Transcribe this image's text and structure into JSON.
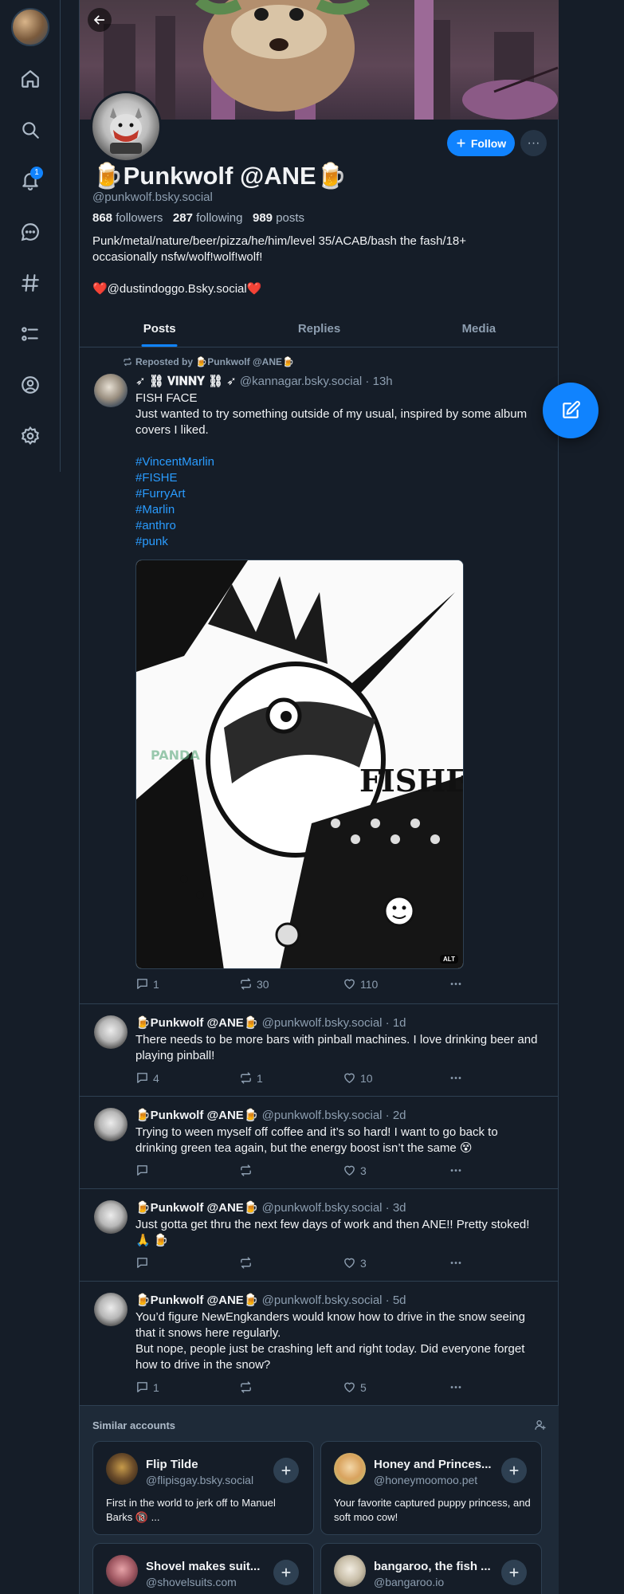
{
  "sidebar": {
    "notifications_badge": "1"
  },
  "profile": {
    "display_name": "🍺Punkwolf @ANE🍺",
    "handle": "@punkwolf.bsky.social",
    "followers_count": "868",
    "followers_label": "followers",
    "following_count": "287",
    "following_label": "following",
    "posts_count": "989",
    "posts_label": "posts",
    "bio_line1": "Punk/metal/nature/beer/pizza/he/him/level 35/ACAB/bash the fash/18+",
    "bio_line2": "occasionally nsfw/wolf!wolf!wolf!",
    "bio_line3": "❤️@dustindoggo.Bsky.social❤️",
    "follow_label": "Follow",
    "more_label": "···"
  },
  "tabs": [
    "Posts",
    "Replies",
    "Media"
  ],
  "feed": {
    "repost_label": "Reposted by 🍺Punkwolf @ANE🍺",
    "posts": [
      {
        "author": "➶ ⛓ 𝐕𝐈𝐍𝐍𝐘 ⛓ ➶",
        "handle": "@kannagar.bsky.social · 13h",
        "text_title": "FISH FACE",
        "text_body": "Just wanted to try something outside of my usual, inspired by some album covers I liked.",
        "hashtags": [
          "#VincentMarlin",
          "#FISHE",
          "#FurryArt",
          "#Marlin",
          "#anthro",
          "#punk"
        ],
        "image_alt_badge": "ALT",
        "image_text": "FISHE",
        "replies": "1",
        "reposts": "30",
        "likes": "110"
      },
      {
        "author": "🍺Punkwolf @ANE🍺",
        "handle": "@punkwolf.bsky.social · 1d",
        "text": "There needs to be more bars with pinball machines. I love drinking beer and playing pinball!",
        "replies": "4",
        "reposts": "1",
        "likes": "10"
      },
      {
        "author": "🍺Punkwolf @ANE🍺",
        "handle": "@punkwolf.bsky.social · 2d",
        "text": "Trying to ween myself off coffee and it’s so hard! I want to go back to drinking green tea again, but the energy boost isn’t the same 😵",
        "replies": "",
        "reposts": "",
        "likes": "3"
      },
      {
        "author": "🍺Punkwolf @ANE🍺",
        "handle": "@punkwolf.bsky.social · 3d",
        "text": "Just gotta get thru the next few days of work and then ANE!! Pretty stoked! 🙏 🍺",
        "replies": "",
        "reposts": "",
        "likes": "3"
      },
      {
        "author": "🍺Punkwolf @ANE🍺",
        "handle": "@punkwolf.bsky.social · 5d",
        "text1": "You’d figure NewEngkanders would know how to drive in the snow seeing that it snows here regularly.",
        "text2": "But nope, people just be crashing left and right today. Did everyone forget how to drive in the snow?",
        "replies": "1",
        "reposts": "",
        "likes": "5"
      }
    ]
  },
  "similar": {
    "title": "Similar accounts",
    "accounts": [
      {
        "name": "Flip Tilde",
        "handle": "@flipisgay.bsky.social",
        "desc": "First in the world to jerk off to Manuel Barks 🔞 ..."
      },
      {
        "name": "Honey and Princes...",
        "handle": "@honeymoomoo.pet",
        "desc": "Your favorite captured puppy princess, and soft moo cow!"
      },
      {
        "name": "Shovel makes suit...",
        "handle": "@shovelsuits.com",
        "desc": ""
      },
      {
        "name": "bangaroo, the fish ...",
        "handle": "@bangaroo.io",
        "desc": ""
      }
    ]
  },
  "colors": {
    "background": "#151d28",
    "accent": "#1083fe",
    "link": "#2a9cff",
    "muted_text": "#8d9eb0",
    "border": "#2e4052"
  }
}
